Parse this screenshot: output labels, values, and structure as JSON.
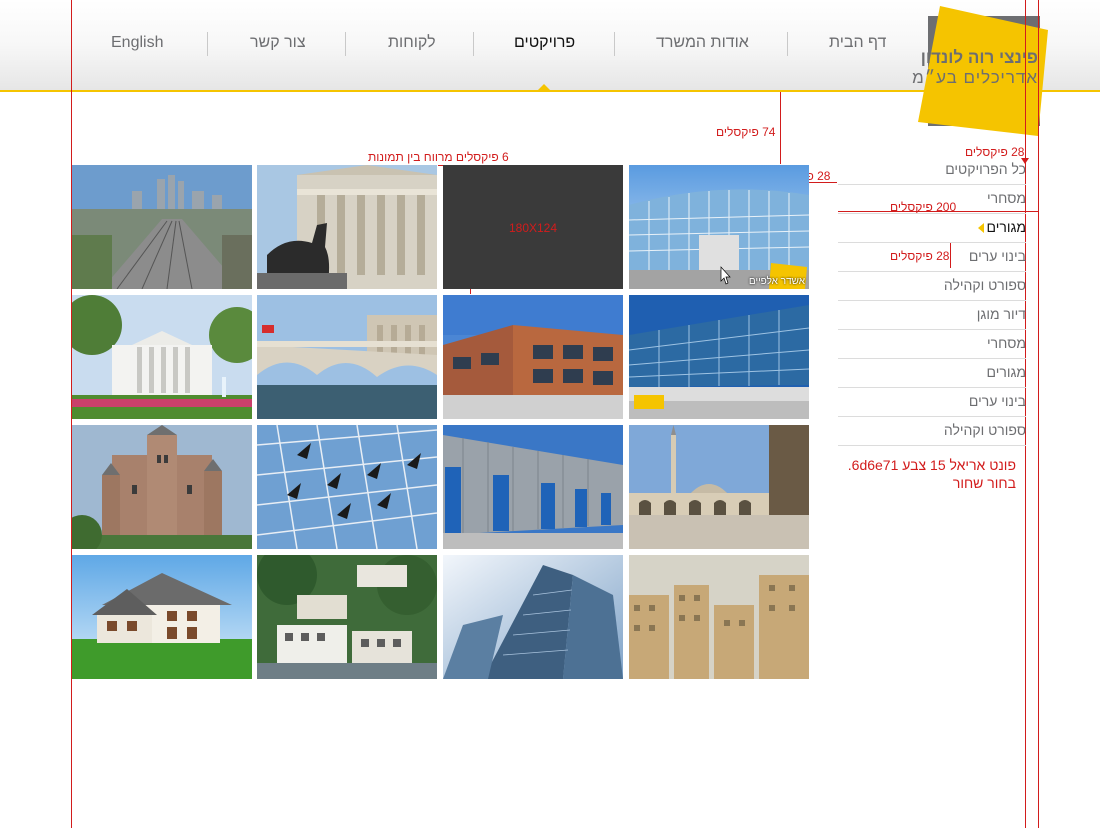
{
  "header": {
    "logo_line1": "פינצי רוה לונדון",
    "logo_line2": "אדריכלים בע״מ",
    "nav": [
      {
        "label": "דף הבית",
        "active": false
      },
      {
        "label": "אודות המשרד",
        "active": false
      },
      {
        "label": "פרויקטים",
        "active": true
      },
      {
        "label": "לקוחות",
        "active": false
      },
      {
        "label": "צור קשר",
        "active": false
      },
      {
        "label": "English",
        "active": false
      }
    ]
  },
  "sidebar": {
    "items": [
      {
        "label": "כל הפרויקטים",
        "active": false
      },
      {
        "label": "מסחרי",
        "active": false
      },
      {
        "label": "מגורים",
        "active": true
      },
      {
        "label": "בינוי ערים",
        "active": false
      },
      {
        "label": "ספורט וקהילה",
        "active": false
      },
      {
        "label": "דיור מוגן",
        "active": false
      },
      {
        "label": "מסחרי",
        "active": false
      },
      {
        "label": "מגורים",
        "active": false
      },
      {
        "label": "בינוי ערים",
        "active": false
      },
      {
        "label": "ספורט וקהילה",
        "active": false
      }
    ]
  },
  "gallery": {
    "placeholder_label": "180X124",
    "caption": "אשדר אלפיים",
    "thumbs": [
      {
        "subject": "modern glass building"
      },
      {
        "subject": "placeholder"
      },
      {
        "subject": "equestrian statue and bank"
      },
      {
        "subject": "city skyline with rail yard"
      },
      {
        "subject": "glass facade building"
      },
      {
        "subject": "brick office building"
      },
      {
        "subject": "stone bridge"
      },
      {
        "subject": "white house"
      },
      {
        "subject": "mosque courtyard"
      },
      {
        "subject": "industrial hangar with blue doors"
      },
      {
        "subject": "glass curtain wall"
      },
      {
        "subject": "castle"
      },
      {
        "subject": "dense city rooftops"
      },
      {
        "subject": "glass skyscraper"
      },
      {
        "subject": "waterfront villas"
      },
      {
        "subject": "suburban house on grass"
      }
    ]
  },
  "annotations": {
    "top_offset": "74 פיקסלים",
    "gap": "6 פיקסלים מרווח בין תמונות",
    "side_gap": "28 פיקסלים",
    "thumb_offset": "28 פיקסלים",
    "sidebar_width": "200 פיקסלים",
    "row_height": "28 פיקסלים",
    "font_note_line1": "פונט אריאל 15 צבע 6d6e71.",
    "font_note_line2": "בחור שחור"
  },
  "colors": {
    "accent": "#f5c400",
    "text": "#6d6e71",
    "annotation": "#d21c1c",
    "placeholder": "#3a3a3a"
  }
}
